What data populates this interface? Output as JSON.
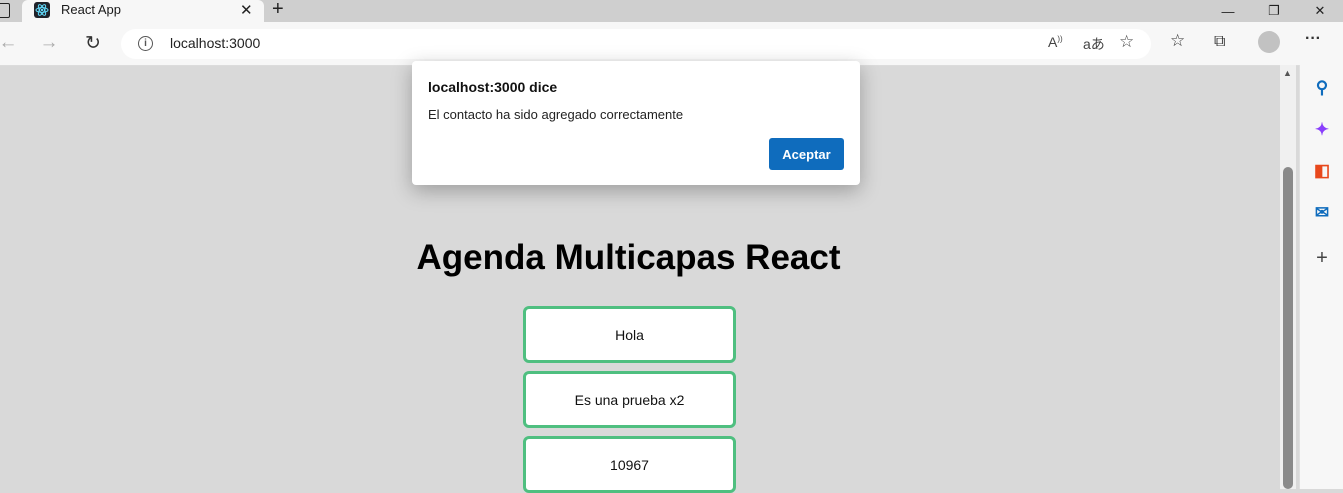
{
  "browser": {
    "tab_title": "React App",
    "url": "localhost:3000"
  },
  "page": {
    "heading": "Agenda Multicapas React",
    "contacts": [
      "Hola",
      "Es una prueba x2",
      "10967"
    ]
  },
  "dialog": {
    "title": "localhost:3000 dice",
    "message": "El contacto ha sido agregado correctamente",
    "ok_label": "Aceptar"
  },
  "colors": {
    "card_border": "#4fbf80",
    "dialog_button": "#0f6cbd",
    "page_background": "#d9d9d9"
  }
}
